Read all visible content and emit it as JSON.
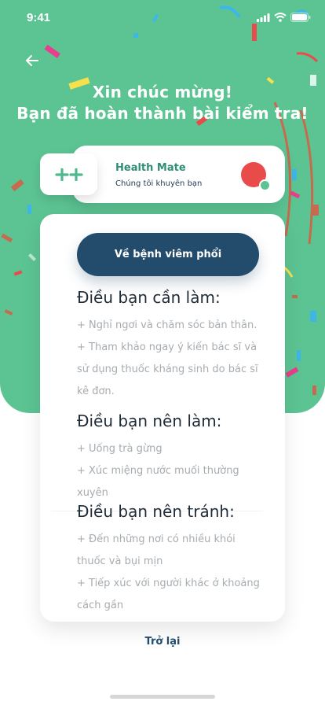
{
  "status_bar": {
    "time": "9:41"
  },
  "header": {
    "title_line1": "Xin chúc mừng!",
    "title_line2": "Bạn đã hoàn thành bài kiểm tra!"
  },
  "brand": {
    "name": "Health Mate",
    "subtitle": "Chúng tôi khuyên bạn",
    "avatar_color": "#e94b4b",
    "accent_color": "#5cc493"
  },
  "diagnosis": {
    "label": "Về bệnh viêm phổi"
  },
  "sections": [
    {
      "heading": "Điều bạn cần làm:",
      "items": [
        "+ Nghỉ ngơi và chăm sóc bản thân.",
        "+ Tham khảo ngay ý kiến bác sĩ và sử dụng thuốc kháng sinh do bác sĩ kê đơn."
      ]
    },
    {
      "heading": "Điều bạn nên làm:",
      "items": [
        "+ Uống trà gừng",
        "+ Xúc miệng nước muối thường xuyên"
      ]
    },
    {
      "heading": "Điều bạn nên tránh:",
      "items": [
        "+ Đến những nơi có nhiều khói thuốc và bụi mịn",
        "+ Tiếp xúc với người khác ở khoảng cách gần"
      ]
    }
  ],
  "footer": {
    "back_label": "Trở lại"
  },
  "colors": {
    "hero_green": "#5cc493",
    "navy": "#234b6b"
  }
}
